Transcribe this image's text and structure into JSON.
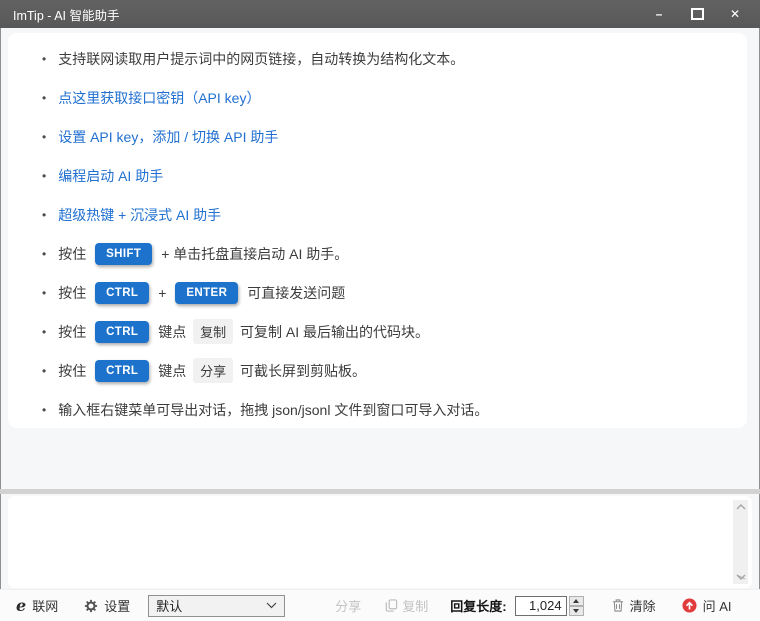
{
  "window": {
    "title": "ImTip - AI 智能助手",
    "controls": {
      "minimize": "–",
      "close": "✕"
    }
  },
  "content": {
    "bullets": [
      {
        "parts": [
          {
            "t": "text",
            "v": "支持联网读取用户提示词中的网页链接，自动转换为结构化文本。"
          }
        ]
      },
      {
        "parts": [
          {
            "t": "link",
            "v": "点这里获取接口密钥（API key）"
          }
        ]
      },
      {
        "parts": [
          {
            "t": "link",
            "v": "设置 API key，添加 / 切换 API 助手"
          }
        ]
      },
      {
        "parts": [
          {
            "t": "link",
            "v": "编程启动 AI 助手"
          }
        ]
      },
      {
        "parts": [
          {
            "t": "link",
            "v": "超级热键 + 沉浸式 AI 助手"
          }
        ]
      },
      {
        "parts": [
          {
            "t": "text",
            "v": "按住 "
          },
          {
            "t": "key",
            "v": "SHIFT"
          },
          {
            "t": "text",
            "v": " + 单击托盘直接启动 AI 助手。"
          }
        ]
      },
      {
        "parts": [
          {
            "t": "text",
            "v": "按住 "
          },
          {
            "t": "key",
            "v": "CTRL"
          },
          {
            "t": "text",
            "v": " + "
          },
          {
            "t": "key",
            "v": "ENTER"
          },
          {
            "t": "text",
            "v": " 可直接发送问题"
          }
        ]
      },
      {
        "parts": [
          {
            "t": "text",
            "v": "按住 "
          },
          {
            "t": "key",
            "v": "CTRL"
          },
          {
            "t": "text",
            "v": " 键点 "
          },
          {
            "t": "chip",
            "v": "复制"
          },
          {
            "t": "text",
            "v": " 可复制 AI 最后输出的代码块。"
          }
        ]
      },
      {
        "parts": [
          {
            "t": "text",
            "v": "按住 "
          },
          {
            "t": "key",
            "v": "CTRL"
          },
          {
            "t": "text",
            "v": " 键点 "
          },
          {
            "t": "chip",
            "v": "分享"
          },
          {
            "t": "text",
            "v": " 可截长屏到剪贴板。"
          }
        ]
      },
      {
        "parts": [
          {
            "t": "text",
            "v": "输入框右键菜单可导出对话，拖拽 json/jsonl 文件到窗口可导入对话。"
          }
        ]
      }
    ]
  },
  "toolbar": {
    "network_label": "联网",
    "settings_label": "设置",
    "preset_selected": "默认",
    "share_label": "分享",
    "copy_label": "复制",
    "reply_length_label": "回复长度:",
    "reply_length_value": "1,024",
    "clear_label": "清除",
    "ask_label": "问 AI"
  },
  "colors": {
    "badge_blue": "#1d72cc",
    "link_blue": "#2170d0",
    "ask_red": "#e23b3b",
    "titlebar_gray": "#5c5c5c",
    "splitter_gray": "#d2d2d2"
  }
}
